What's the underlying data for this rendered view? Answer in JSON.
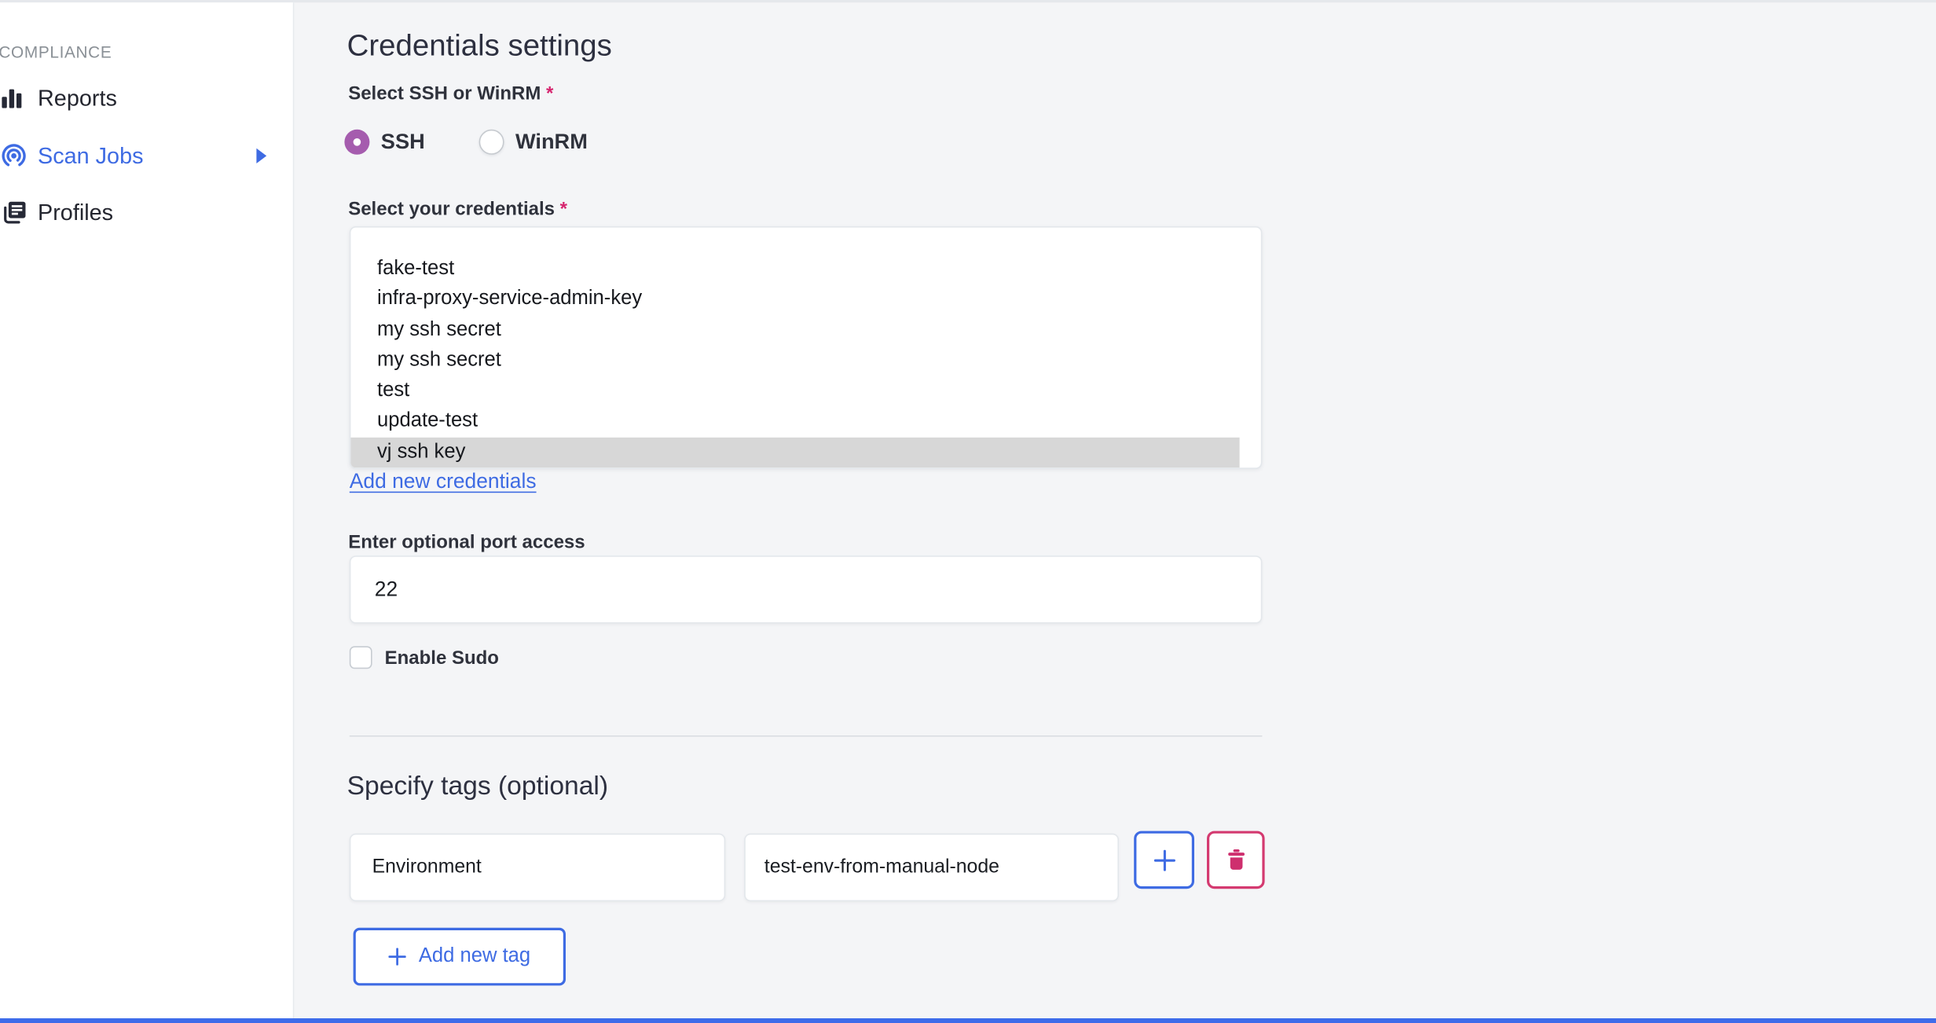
{
  "sidebar": {
    "section_label": "COMPLIANCE",
    "items": [
      {
        "label": "Reports",
        "icon": "bar-chart-icon",
        "active": false
      },
      {
        "label": "Scan Jobs",
        "icon": "scan-icon",
        "active": true,
        "has_submenu": true
      },
      {
        "label": "Profiles",
        "icon": "profiles-icon",
        "active": false
      }
    ]
  },
  "main": {
    "title": "Credentials settings",
    "required_marker": "*",
    "protocol": {
      "label": "Select SSH or WinRM",
      "options": [
        {
          "label": "SSH",
          "selected": true
        },
        {
          "label": "WinRM",
          "selected": false
        }
      ]
    },
    "credentials": {
      "label": "Select your credentials",
      "options": [
        "fake-test",
        "infra-proxy-service-admin-key",
        "my ssh secret",
        "my ssh secret",
        "test",
        "update-test",
        "vj ssh key"
      ],
      "selected_option": "vj ssh key",
      "add_link": "Add new credentials"
    },
    "port": {
      "label": "Enter optional port access",
      "value": "22"
    },
    "sudo": {
      "label": "Enable Sudo",
      "checked": false
    },
    "tags": {
      "title": "Specify tags (optional)",
      "rows": [
        {
          "key": "Environment",
          "value": "test-env-from-manual-node"
        }
      ],
      "add_button_label": "Add new tag"
    }
  },
  "colors": {
    "accent_blue": "#3e6be3",
    "radio_selected_purple": "#a55cae",
    "required_pink": "#d6246e",
    "delete_pink_border": "#d43a70",
    "selected_row_gray": "#d7d7d7",
    "background_gray": "#f4f5f7",
    "bottom_bar_blue": "#3e6cea"
  }
}
